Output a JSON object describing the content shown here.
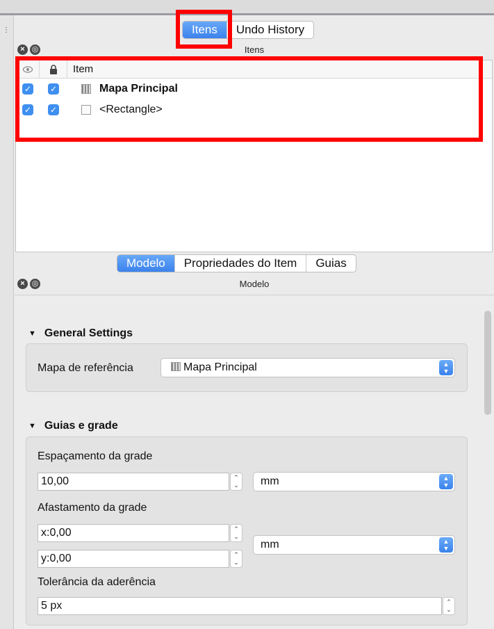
{
  "items_panel": {
    "tabs": [
      "Itens",
      "Undo History"
    ],
    "title": "Itens",
    "columns": {
      "item": "Item"
    },
    "rows": [
      {
        "label": "Mapa Principal",
        "visible": true,
        "locked": true,
        "bold": true
      },
      {
        "label": "<Rectangle>",
        "visible": true,
        "locked": true,
        "bold": false
      }
    ]
  },
  "modelo_panel": {
    "tabs": [
      "Modelo",
      "Propriedades do Item",
      "Guias"
    ],
    "title": "Modelo",
    "general_settings": {
      "heading": "General Settings",
      "reference_map_label": "Mapa de referência",
      "reference_map_value": "Mapa Principal"
    },
    "guides_grid": {
      "heading": "Guias e grade",
      "spacing_label": "Espaçamento da grade",
      "spacing_value": "10,00",
      "spacing_unit": "mm",
      "offset_label": "Afastamento da grade",
      "offset_x": "x:0,00",
      "offset_y": "y:0,00",
      "offset_unit": "mm",
      "snap_label": "Tolerância da aderência",
      "snap_value": "5 px"
    }
  },
  "colors": {
    "highlight": "#ff0000",
    "accent": "#3b82ec"
  }
}
